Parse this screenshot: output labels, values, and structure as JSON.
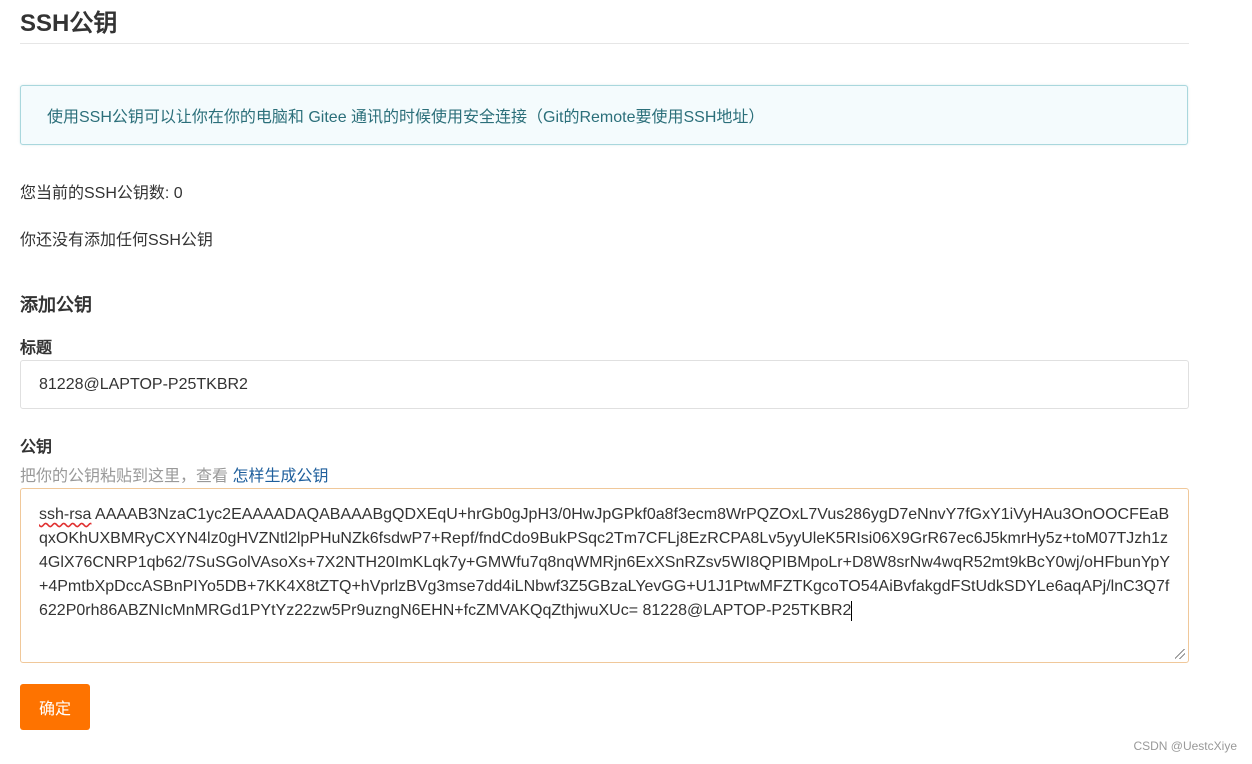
{
  "page": {
    "title": "SSH公钥"
  },
  "info": {
    "text": "使用SSH公钥可以让你在你的电脑和 Gitee 通讯的时候使用安全连接（Git的Remote要使用SSH地址）"
  },
  "status": {
    "count_text": "您当前的SSH公钥数: 0",
    "empty_text": "你还没有添加任何SSH公钥"
  },
  "add_key": {
    "section_title": "添加公钥",
    "title_label": "标题",
    "title_value": "81228@LAPTOP-P25TKBR2",
    "key_label": "公钥",
    "key_hint": "把你的公钥粘贴到这里，查看 ",
    "key_hint_link": "怎样生成公钥",
    "key_prefix": "ssh-rsa",
    "key_body": " AAAAB3NzaC1yc2EAAAADAQABAAABgQDXEqU+hrGb0gJpH3/0HwJpGPkf0a8f3ecm8WrPQZOxL7Vus286ygD7eNnvY7fGxY1iVyHAu3OnOOCFEaBqxOKhUXBMRyCXYN4lz0gHVZNtl2lpPHuNZk6fsdwP7+Repf/fndCdo9BukPSqc2Tm7CFLj8EzRCPA8Lv5yyUleK5RIsi06X9GrR67ec6J5kmrHy5z+toM07TJzh1z4GlX76CNRP1qb62/7SuSGolVAsoXs+7X2NTH20ImKLqk7y+GMWfu7q8nqWMRjn6ExXSnRZsv5WI8QPIBMpoLr+D8W8srNw4wqR52mt9kBcY0wj/oHFbunYpY+4PmtbXpDccASBnPIYo5DB+7KK4X8tZTQ+hVprlzBVg3mse7dd4iLNbwf3Z5GBzaLYevGG+U1J1PtwMFZTKgcoTO54AiBvfakgdFStUdkSDYLe6aqAPj/lnC3Q7f622P0rh86ABZNIcMnMRGd1PYtYz22zw5Pr9uzngN6EHN+fcZMVAKQqZthjwuXUc= 81228@LAPTOP-P25TKBR2",
    "confirm_label": "确定"
  },
  "watermark": "CSDN @UestcXiye",
  "colors": {
    "accent": "#fe7300",
    "info_bg": "#f4fbfd",
    "info_border": "#a9d7dd",
    "link": "#1f5f9c"
  }
}
